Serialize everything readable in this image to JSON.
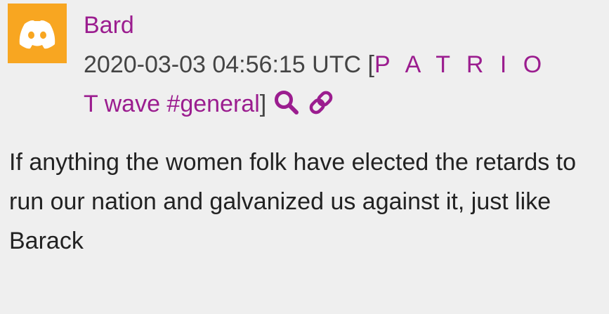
{
  "post": {
    "author": "Bard",
    "timestamp": "2020-03-03 04:56:15 UTC",
    "bracket_open": "[",
    "bracket_close": "]",
    "channel_spaced": "P A T R I O",
    "channel_rest": "T wave #general",
    "message": "If anything the women folk have elected the retards to run our nation and galvanized us against it, just like Barack"
  },
  "icons": {
    "avatar": "discord-logo-icon",
    "search": "search-icon",
    "permalink": "link-icon"
  },
  "colors": {
    "background": "#efefef",
    "accent": "#9b1d8f",
    "avatar_bg": "#f8a621",
    "text": "#333333"
  }
}
